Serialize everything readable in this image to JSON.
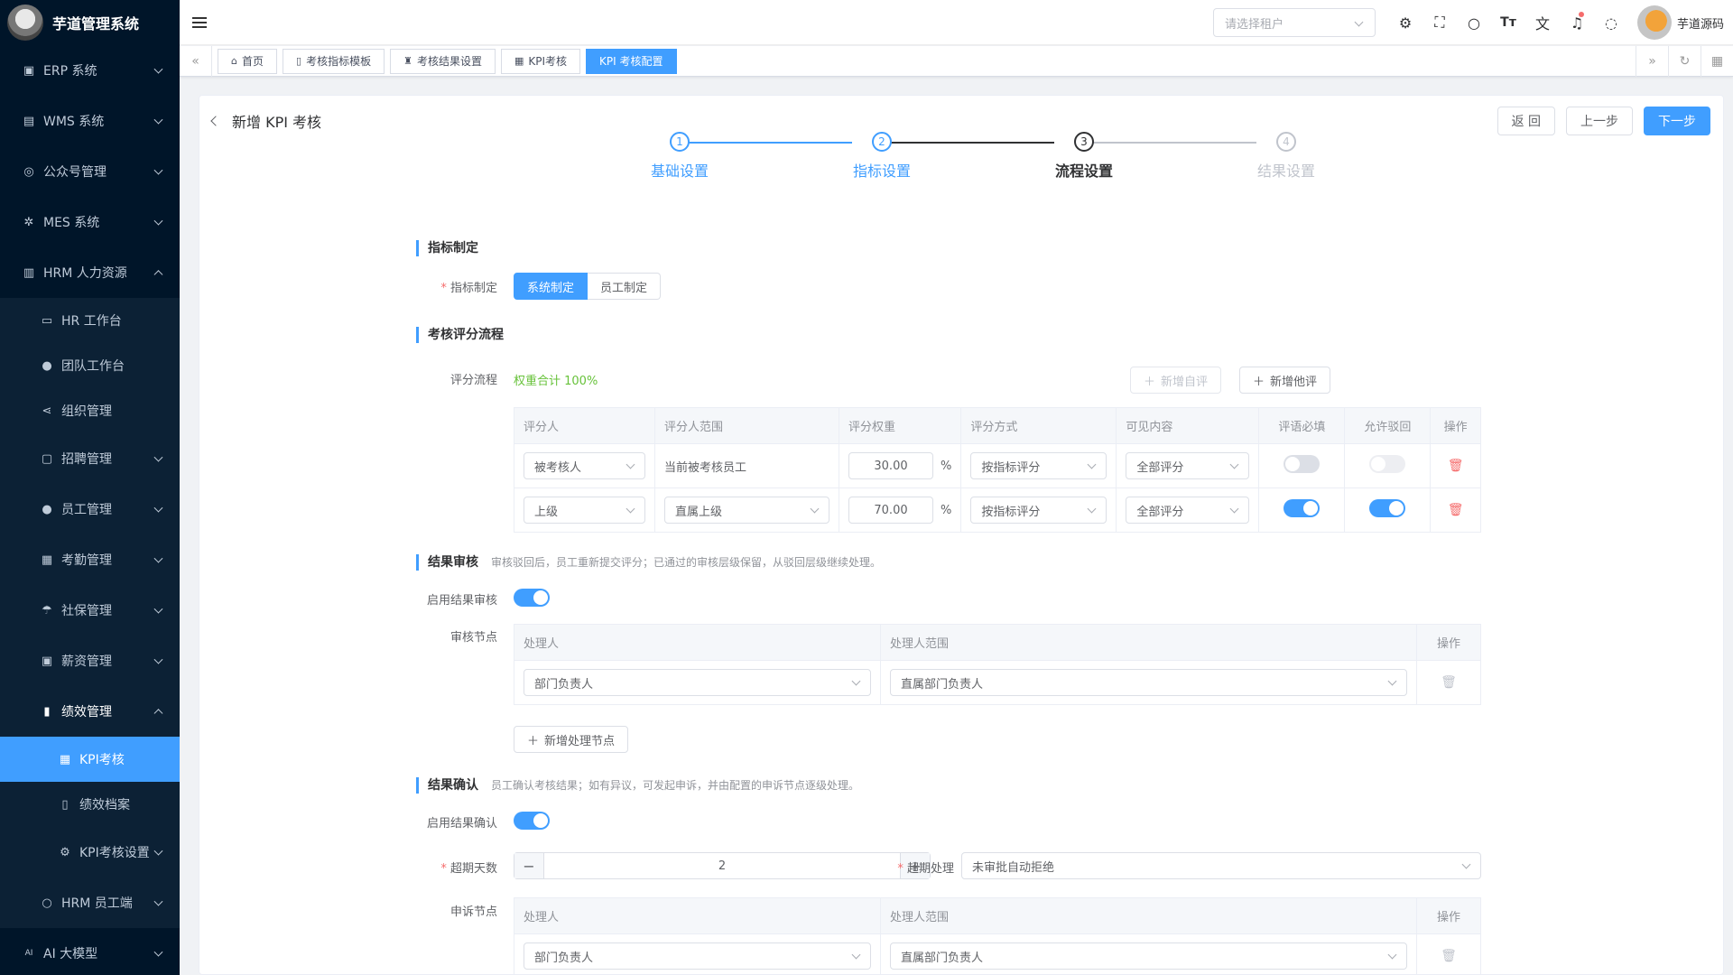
{
  "app": {
    "title": "芋道管理系统"
  },
  "sidebar": {
    "items": [
      {
        "label": "ERP 系统",
        "icon": "erp-icon"
      },
      {
        "label": "WMS 系统",
        "icon": "box-icon"
      },
      {
        "label": "公众号管理",
        "icon": "compass-icon"
      },
      {
        "label": "MES 系统",
        "icon": "chip-icon"
      },
      {
        "label": "HRM 人力资源",
        "icon": "building-icon"
      }
    ],
    "hrm_sub": [
      {
        "label": "HR 工作台"
      },
      {
        "label": "团队工作台"
      },
      {
        "label": "组织管理"
      },
      {
        "label": "招聘管理"
      },
      {
        "label": "员工管理"
      },
      {
        "label": "考勤管理"
      },
      {
        "label": "社保管理"
      },
      {
        "label": "薪资管理"
      },
      {
        "label": "绩效管理"
      }
    ],
    "perf_sub": [
      {
        "label": "KPI考核"
      },
      {
        "label": "绩效档案"
      },
      {
        "label": "KPI考核设置"
      }
    ],
    "tail": [
      {
        "label": "HRM 员工端"
      },
      {
        "label": "AI 大模型"
      }
    ]
  },
  "navbar": {
    "tenant_placeholder": "请选择租户",
    "username": "芋道源码"
  },
  "tags": [
    {
      "label": "首页"
    },
    {
      "label": "考核指标模板"
    },
    {
      "label": "考核结果设置"
    },
    {
      "label": "KPI考核"
    },
    {
      "label": "KPI 考核配置"
    }
  ],
  "page": {
    "title": "新增 KPI 考核",
    "back": "返 回",
    "prev": "上一步",
    "next": "下一步"
  },
  "steps": [
    {
      "num": "1",
      "title": "基础设置"
    },
    {
      "num": "2",
      "title": "指标设置"
    },
    {
      "num": "3",
      "title": "流程设置"
    },
    {
      "num": "4",
      "title": "结果设置"
    }
  ],
  "sec1": {
    "title": "指标制定",
    "label": "指标制定",
    "opt_system": "系统制定",
    "opt_staff": "员工制定"
  },
  "sec2": {
    "title": "考核评分流程",
    "label": "评分流程",
    "weight_total": "权重合计 100%",
    "add_self": "新增自评",
    "add_other": "新增他评",
    "headers": [
      "评分人",
      "评分人范围",
      "评分权重",
      "评分方式",
      "可见内容",
      "评语必填",
      "允许驳回",
      "操作"
    ],
    "rows": [
      {
        "scorer": "被考核人",
        "range": "当前被考核员工",
        "weight": "30.00",
        "unit": "%",
        "method": "按指标评分",
        "visible": "全部评分"
      },
      {
        "scorer": "上级",
        "range": "直属上级",
        "weight": "70.00",
        "unit": "%",
        "method": "按指标评分",
        "visible": "全部评分"
      }
    ]
  },
  "sec3": {
    "title": "结果审核",
    "desc": "审核驳回后，员工重新提交评分；已通过的审核层级保留，从驳回层级继续处理。",
    "enable_label": "启用结果审核",
    "node_label": "审核节点",
    "headers": [
      "处理人",
      "处理人范围",
      "操作"
    ],
    "row": {
      "handler": "部门负责人",
      "range": "直属部门负责人"
    },
    "add_node": "新增处理节点"
  },
  "sec4": {
    "title": "结果确认",
    "desc": "员工确认考核结果；如有异议，可发起申诉，并由配置的申诉节点逐级处理。",
    "enable_label": "启用结果确认",
    "days_label": "超期天数",
    "days_value": "2",
    "overdue_label": "超期处理",
    "overdue_value": "未审批自动拒绝",
    "appeal_label": "申诉节点",
    "headers": [
      "处理人",
      "处理人范围",
      "操作"
    ],
    "row": {
      "handler": "部门负责人",
      "range": "直属部门负责人"
    }
  }
}
